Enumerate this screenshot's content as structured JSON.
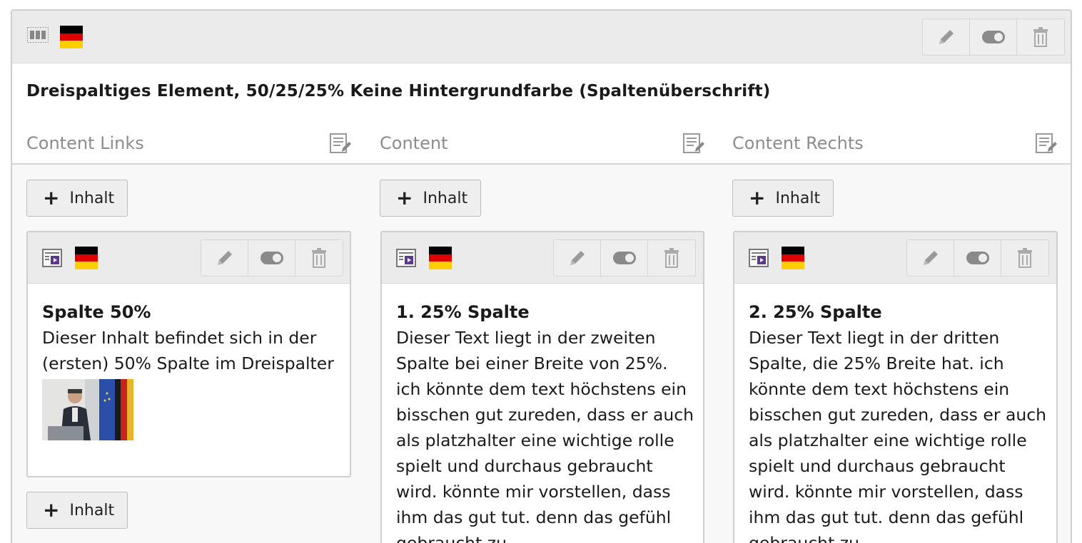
{
  "element": {
    "title": "Dreispaltiges Element, 50/25/25% Keine Hintergrundfarbe (Spaltenüberschrift)",
    "icons": {
      "type": "three-columns-icon",
      "language": "german-flag-icon",
      "edit": "pencil-icon",
      "toggle": "toggle-icon",
      "delete": "trash-icon"
    }
  },
  "columns": [
    {
      "label": "Content Links",
      "add_label": "Inhalt",
      "card": {
        "title": "Spalte 50%",
        "text": "Dieser Inhalt befindet sich in der (ersten) 50% Spalte im Dreispalter",
        "has_image": true
      },
      "add_label_bottom": "Inhalt"
    },
    {
      "label": "Content",
      "add_label": "Inhalt",
      "card": {
        "title": "1. 25% Spalte",
        "text": "Dieser Text liegt in der zweiten Spalte bei einer Breite von 25%. ich könnte dem text höchstens ein bisschen gut zureden, dass er auch als platzhalter eine wichtige rolle spielt und durchaus gebraucht wird. könnte mir vorstellen, dass ihm das gut tut. denn das gefühl gebraucht zu"
      }
    },
    {
      "label": "Content Rechts",
      "add_label": "Inhalt",
      "card": {
        "title": "2. 25% Spalte",
        "text": "Dieser Text liegt in der dritten Spalte, die 25% Breite hat. ich könnte dem text höchstens ein bisschen gut zureden, dass er auch als platzhalter eine wichtige rolle spielt und durchaus gebraucht wird. könnte mir vorstellen, dass ihm das gut tut. denn das gefühl gebraucht zu"
      }
    }
  ],
  "colors": {
    "header_bg": "#ebebeb",
    "label_gray": "#8c8c8c",
    "flag_black": "#000000",
    "flag_red": "#dd0000",
    "flag_gold": "#ffce00",
    "ce_icon_accent": "#5b3a8e"
  }
}
